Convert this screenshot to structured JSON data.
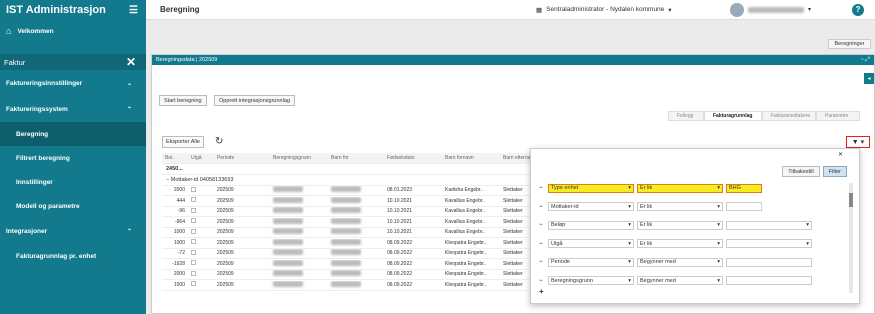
{
  "app": {
    "title": "IST Administrasjon"
  },
  "sidebar": {
    "home": "Velkommen",
    "section": "Faktur",
    "items": [
      {
        "label": "Faktureringsinnstillinger",
        "chevron": "⌄"
      },
      {
        "label": "Faktureringssystem",
        "chevron": "⌃"
      },
      {
        "label": "Beregning"
      },
      {
        "label": "Filtrert beregning"
      },
      {
        "label": "Innstillinger"
      },
      {
        "label": "Modell og parametre"
      },
      {
        "label": "Integrasjoner",
        "chevron": "⌃"
      },
      {
        "label": "Fakturagrunnlag pr. enhet"
      }
    ]
  },
  "topbar": {
    "page_title": "Beregning",
    "org": "Sentraladministrator - Nydalen kommune"
  },
  "beregninger_button": "Beregninger",
  "panel": {
    "title": "Beregningsdata | 202509"
  },
  "actions": {
    "start": "Start beregning",
    "opprett": "Opprett integrasjonsgrunnlag"
  },
  "tabs": [
    "Fellogg",
    "Fakturagrunnlag",
    "Fakturamottakere",
    "Parametre"
  ],
  "export": "Eksporter Alle",
  "grid": {
    "headers": [
      "Bel..",
      "Utgå",
      "Periode",
      "Beregningsgrunn",
      "Barn fnr",
      "Fødselsdato",
      "Barn fornavn",
      "Barn etternavn"
    ],
    "group_total": "2450...",
    "group_label": "Mottaker-id 04058133693",
    "rows": [
      {
        "bel": "2000",
        "periode": "202509",
        "dato": "08.01.2023",
        "fornavn": "Kadisha Engebr..",
        "etternavn": "Slettaker"
      },
      {
        "bel": "444",
        "periode": "202509",
        "dato": "10.10.2021",
        "fornavn": "Kavallius Engebr..",
        "etternavn": "Slettaker"
      },
      {
        "bel": "-96",
        "periode": "202509",
        "dato": "10.10.2021",
        "fornavn": "Kavallius Engebr..",
        "etternavn": "Slettaker"
      },
      {
        "bel": "-964",
        "periode": "202509",
        "dato": "10.10.2021",
        "fornavn": "Kavallius Engebr..",
        "etternavn": "Slettaker"
      },
      {
        "bel": "1000",
        "periode": "202509",
        "dato": "10.10.2021",
        "fornavn": "Kavallius Engebr..",
        "etternavn": "Slettaker"
      },
      {
        "bel": "1000",
        "periode": "202509",
        "dato": "08.09.2022",
        "fornavn": "Kleopatra Engebr..",
        "etternavn": "Slettaker"
      },
      {
        "bel": "-72",
        "periode": "202509",
        "dato": "08.09.2022",
        "fornavn": "Kleopatra Engebr..",
        "etternavn": "Slettaker"
      },
      {
        "bel": "-1928",
        "periode": "202509",
        "dato": "08.09.2022",
        "fornavn": "Kleopatra Engebr..",
        "etternavn": "Slettaker"
      },
      {
        "bel": "2000",
        "periode": "202509",
        "dato": "08.09.2022",
        "fornavn": "Kleopatra Engebr..",
        "etternavn": "Slettaker"
      },
      {
        "bel": "1000",
        "periode": "202509",
        "dato": "08.09.2022",
        "fornavn": "Kleopatra Engebr..",
        "etternavn": "Slettaker"
      }
    ]
  },
  "filter": {
    "reset": "Tilbakestill",
    "apply": "Filter",
    "rows": [
      {
        "field": "Type enhet",
        "op": "Er lik",
        "value": "BHG",
        "highlight": true
      },
      {
        "field": "Mottaker-id",
        "op": "Er lik",
        "value": ""
      },
      {
        "field": "Beløp",
        "op": "Er lik",
        "value": ""
      },
      {
        "field": "Utgå",
        "op": "Er lik",
        "value": ""
      },
      {
        "field": "Periode",
        "op": "Begynner med",
        "value": ""
      },
      {
        "field": "Beregningsgrunn",
        "op": "Begynner med",
        "value": ""
      }
    ],
    "add": "+"
  },
  "colors": {
    "accent": "#127a8c",
    "highlight": "#f7ec1e",
    "highlight_border": "#e07a1a",
    "alert": "#dd2222"
  }
}
